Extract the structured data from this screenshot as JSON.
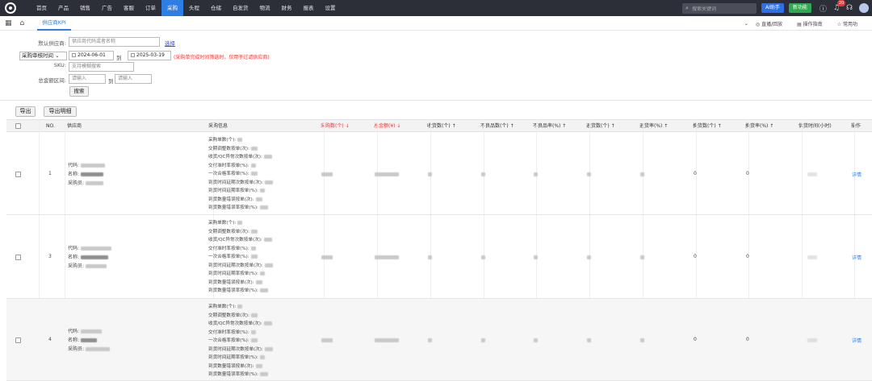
{
  "nav": {
    "items": [
      "首页",
      "产品",
      "销售",
      "广告",
      "客服",
      "订单",
      "采购",
      "头程",
      "仓储",
      "自发货",
      "物流",
      "财务",
      "报表",
      "设置"
    ],
    "active_index": 6,
    "search_placeholder": "搜索关键词",
    "ai_label": "AI助手",
    "new_feature_label": "新功能",
    "notification_count": "20"
  },
  "tabs": {
    "active": "供应商KPI",
    "right": [
      "直播/回放",
      "操作指南",
      "常用功"
    ]
  },
  "filters": {
    "supplier_label": "默认供应商:",
    "supplier_placeholder": "供应商代码或者名称",
    "select_link": "选择",
    "time_select": "采购审核时间",
    "date_from": "2024-06-01",
    "date_sep": "到",
    "date_to": "2025-03-19",
    "date_note": "(采购单完成时间筛选时，仅用于过滤供应商)",
    "sku_label": "SKU:",
    "sku_placeholder": "支持模糊搜索",
    "amount_label": "总金额区间:",
    "amount_from_placeholder": "请输入",
    "amount_sep": "到",
    "amount_to_placeholder": "请输入",
    "search_button": "搜索"
  },
  "toolbar": {
    "export": "导出",
    "export_detail": "导出明细"
  },
  "table": {
    "headers": {
      "no": "NO.",
      "supplier": "供应商",
      "purchase_info": "采购信息",
      "purchase_qty": "采购数(个) ↓",
      "total_amount": "总金额(¥) ↓",
      "received_qty": "收货数(个) ↑",
      "defect_qty": "不良品数(个) ↑",
      "defect_rate": "不良品率(%) ↑",
      "return_qty": "退货数(个) ↑",
      "return_rate": "退货率(%) ↑",
      "exchange_qty": "换货数(个) ↑",
      "exchange_rate": "换货率(%) ↑",
      "lead_time": "供货时间(小时)",
      "action": "操作"
    },
    "supplier_fields": [
      "代码:",
      "名称:",
      "采购员:"
    ],
    "metric_labels": [
      "采购单数(个):",
      "交期调整数按单(次):",
      "收货/QC异常次数按单(次):",
      "交付准时率按单(%):",
      "一次合格率按单(%):",
      "到货时间延期次数按单(次):",
      "到货时间延期率按单(%):",
      "到货数量错误按单(次):",
      "到货数量错误率按单(%):"
    ],
    "rows": [
      {
        "no": "1",
        "exchange_qty": "0",
        "exchange_rate": "0",
        "action": "详情"
      },
      {
        "no": "3",
        "exchange_qty": "0",
        "exchange_rate": "0",
        "action": "详情"
      },
      {
        "no": "4",
        "exchange_qty": "0",
        "exchange_rate": "0",
        "action": "详情"
      }
    ]
  }
}
